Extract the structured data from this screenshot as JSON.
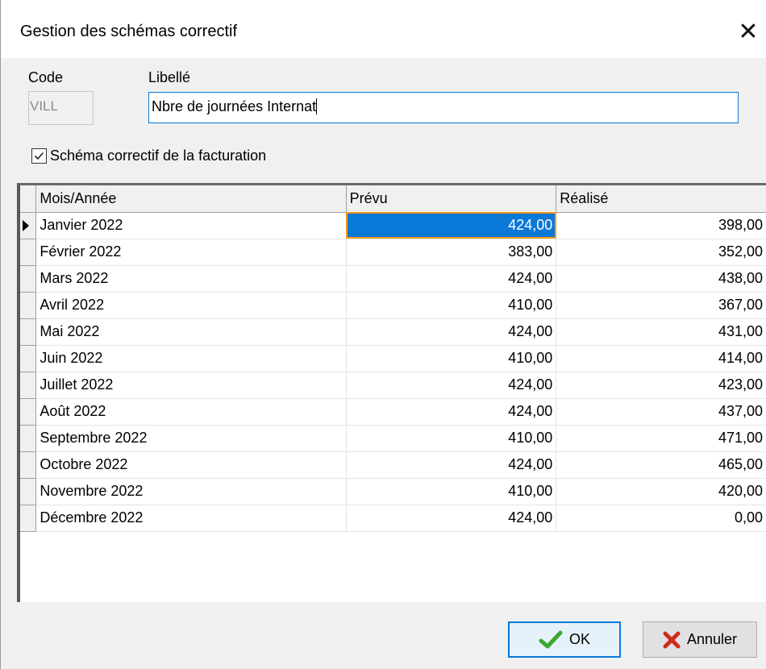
{
  "window": {
    "title": "Gestion des schémas correctif",
    "close_icon": "close-icon"
  },
  "form": {
    "code_label": "Code",
    "code_value": "VILL",
    "libelle_label": "Libellé",
    "libelle_value": "Nbre de journées Internat",
    "checkbox_label": "Schéma correctif de la facturation",
    "checkbox_checked": true
  },
  "grid": {
    "columns": [
      "Mois/Année",
      "Prévu",
      "Réalisé"
    ],
    "rows": [
      {
        "mois": "Janvier 2022",
        "prevu": "424,00",
        "realise": "398,00",
        "current": true
      },
      {
        "mois": "Février 2022",
        "prevu": "383,00",
        "realise": "352,00"
      },
      {
        "mois": "Mars 2022",
        "prevu": "424,00",
        "realise": "438,00"
      },
      {
        "mois": "Avril 2022",
        "prevu": "410,00",
        "realise": "367,00"
      },
      {
        "mois": "Mai 2022",
        "prevu": "424,00",
        "realise": "431,00"
      },
      {
        "mois": "Juin 2022",
        "prevu": "410,00",
        "realise": "414,00"
      },
      {
        "mois": "Juillet 2022",
        "prevu": "424,00",
        "realise": "423,00"
      },
      {
        "mois": "Août 2022",
        "prevu": "424,00",
        "realise": "437,00"
      },
      {
        "mois": "Septembre 2022",
        "prevu": "410,00",
        "realise": "471,00"
      },
      {
        "mois": "Octobre 2022",
        "prevu": "424,00",
        "realise": "465,00"
      },
      {
        "mois": "Novembre 2022",
        "prevu": "410,00",
        "realise": "420,00"
      },
      {
        "mois": "Décembre 2022",
        "prevu": "424,00",
        "realise": "0,00"
      }
    ],
    "selection_color": "#0a78d7",
    "focus_color": "#ff9a1a"
  },
  "buttons": {
    "ok_label": "OK",
    "ok_icon": "checkmark-icon",
    "cancel_label": "Annuler",
    "cancel_icon": "x-icon"
  }
}
